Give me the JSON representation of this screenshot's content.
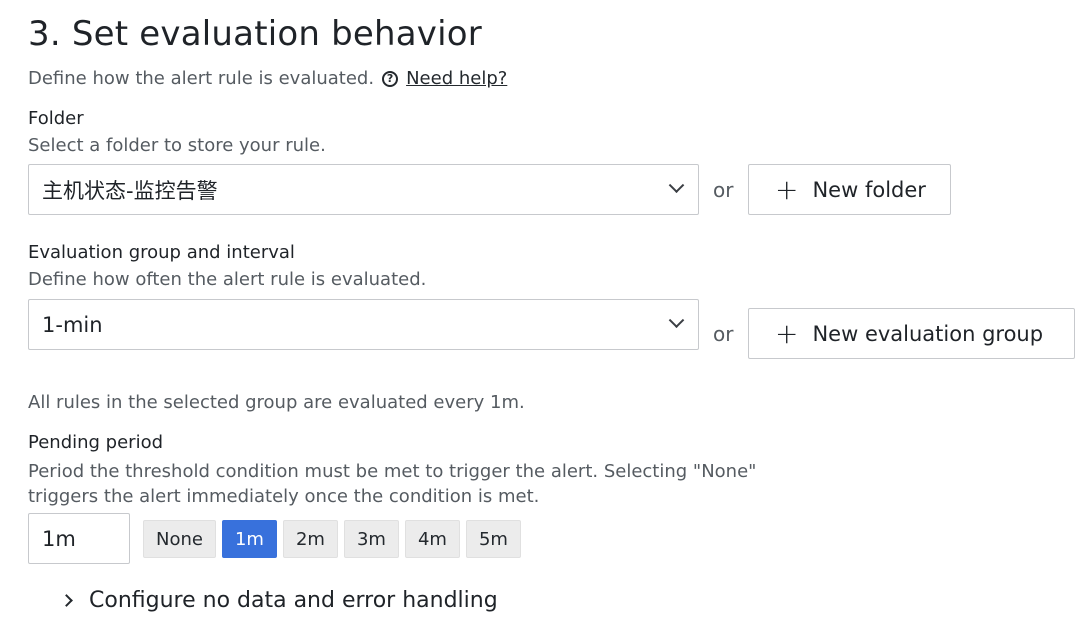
{
  "section": {
    "title": "3. Set evaluation behavior",
    "subtitle": "Define how the alert rule is evaluated.",
    "help_link": "Need help?"
  },
  "folder": {
    "label": "Folder",
    "description": "Select a folder to store your rule.",
    "value": "主机状态-监控告警",
    "or_text": "or",
    "new_button": "New folder"
  },
  "group": {
    "label": "Evaluation group and interval",
    "description": "Define how often the alert rule is evaluated.",
    "value": "1-min",
    "or_text": "or",
    "new_button": "New evaluation group",
    "note": "All rules in the selected group are evaluated every 1m."
  },
  "pending": {
    "label": "Pending period",
    "description_line1": "Period the threshold condition must be met to trigger the alert. Selecting \"None\"",
    "description_line2": "triggers the alert immediately once the condition is met.",
    "value": "1m",
    "options": [
      "None",
      "1m",
      "2m",
      "3m",
      "4m",
      "5m"
    ],
    "selected": "1m"
  },
  "collapse": {
    "label": "Configure no data and error handling"
  },
  "icons": {
    "help": "help-circle-icon",
    "chevron_down": "chevron-down-icon",
    "plus": "plus-icon",
    "chevron_right": "chevron-right-icon"
  },
  "colors": {
    "accent": "#3871dc"
  }
}
